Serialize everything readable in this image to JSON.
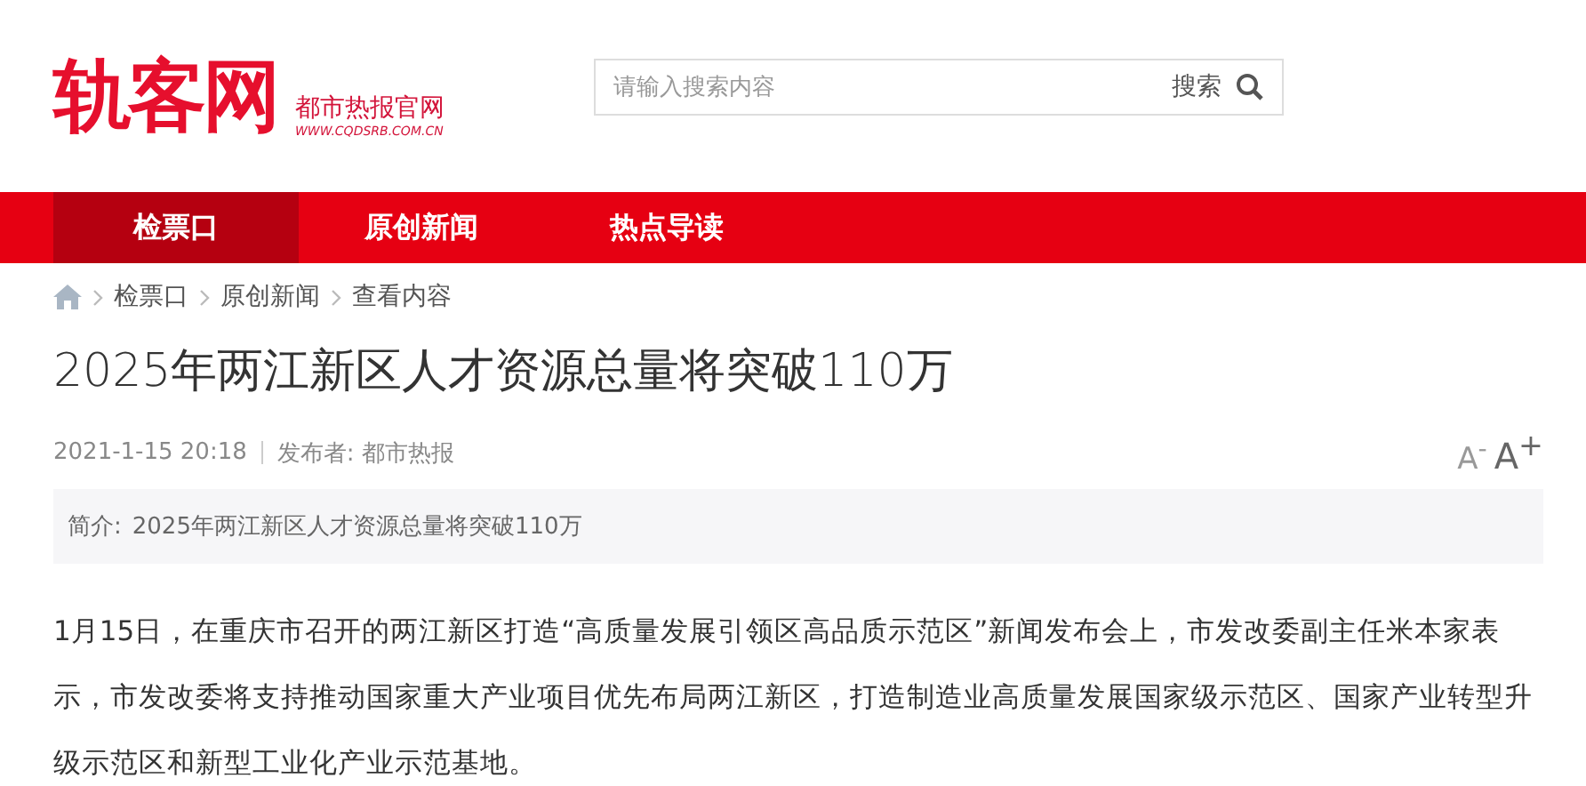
{
  "logo": {
    "name": "轨客网",
    "tagline": "都市热报官网",
    "url": "WWW.CQDSRB.COM.CN"
  },
  "search": {
    "placeholder": "请输入搜索内容",
    "button": "搜索"
  },
  "nav": [
    {
      "label": "检票口",
      "selected": true
    },
    {
      "label": "原创新闻",
      "selected": false
    },
    {
      "label": "热点导读",
      "selected": false
    }
  ],
  "breadcrumb": [
    "检票口",
    "原创新闻",
    "查看内容"
  ],
  "article": {
    "title": "2025年两江新区人才资源总量将突破110万",
    "date": "2021-1-15 20:18",
    "publisher_label": "发布者:",
    "publisher": "都市热报",
    "font_buttons": [
      "A$^{-}$",
      "A$^{+}$"
    ],
    "summary_label": "简介:",
    "summary": "2025年两江新区人才资源总量将突破110万",
    "body": "1月15日，在重庆市召开的两江新区打造“高质量发展引领区高品质示范区”新闻发布会上，市发改委副主任米本家表示，市发改委将支持推动国家重大产业项目优先布局两江新区，打造制造业高质量发展国家级示范区、国家产业转型升级示范区和新型工业化产业示范基地。"
  }
}
